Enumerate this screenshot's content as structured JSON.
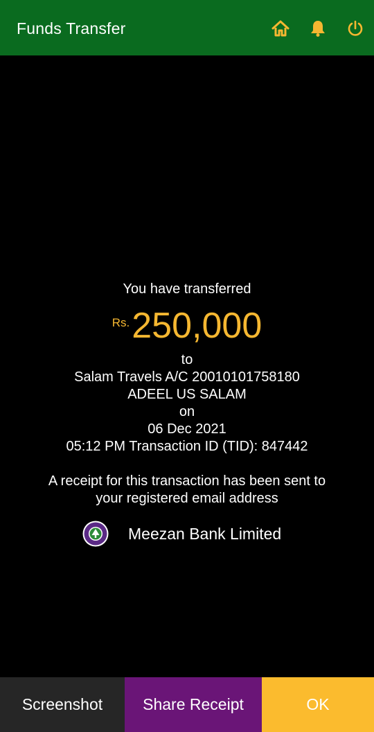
{
  "header": {
    "title": "Funds Transfer",
    "icons": [
      "home-icon",
      "bell-icon",
      "power-icon"
    ]
  },
  "receipt": {
    "intro": "You have transferred",
    "currency": "Rs.",
    "amount": "250,000",
    "to_label": "to",
    "recipient": "Salam Travels A/C 20010101758180",
    "recipient_name": "ADEEL US SALAM",
    "on_label": "on",
    "date": "06 Dec 2021",
    "time_tid": "05:12 PM Transaction ID (TID): 847442",
    "note_line1": "A receipt for this transaction has been sent to",
    "note_line2": "your registered email address",
    "bank_name": "Meezan Bank Limited"
  },
  "actions": {
    "screenshot": "Screenshot",
    "share": "Share Receipt",
    "ok": "OK"
  },
  "colors": {
    "header_bg": "#0a6b1f",
    "accent_gold": "#f5b731",
    "share_bg": "#6a1577",
    "ok_bg": "#fbbb2e",
    "screenshot_bg": "#262626"
  }
}
